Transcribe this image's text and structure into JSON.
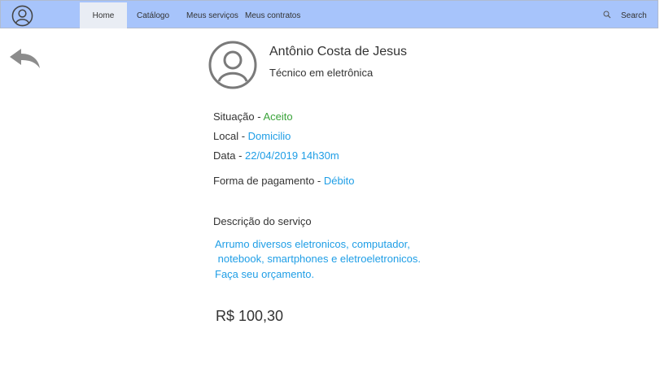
{
  "nav": {
    "items": [
      "Home",
      "Catálogo",
      "Meus serviços",
      "Meus contratos"
    ],
    "search_label": "Search",
    "icons": {
      "avatar": "user-circle-icon",
      "search": "search-icon"
    }
  },
  "profile": {
    "name": "Antônio Costa de Jesus",
    "role": "Técnico em eletrônica"
  },
  "details": {
    "situacao_label": "Situação - ",
    "situacao_value": "Aceito",
    "local_label": "Local - ",
    "local_value": "Domicilio",
    "data_label": "Data - ",
    "data_value": "22/04/2019 14h30m",
    "pagamento_label": "Forma de pagamento - ",
    "pagamento_value": "Débito"
  },
  "description": {
    "heading": "Descrição  do serviço",
    "lines": [
      "Arrumo diversos eletronicos, computador,",
      " notebook, smartphones e eletroeletronicos.",
      "Faça seu orçamento."
    ]
  },
  "price": "R$ 100,30",
  "colors": {
    "navbar": "#a7c4fb",
    "accent": "#1f9ee6",
    "status_accepted": "#3aa33a"
  }
}
